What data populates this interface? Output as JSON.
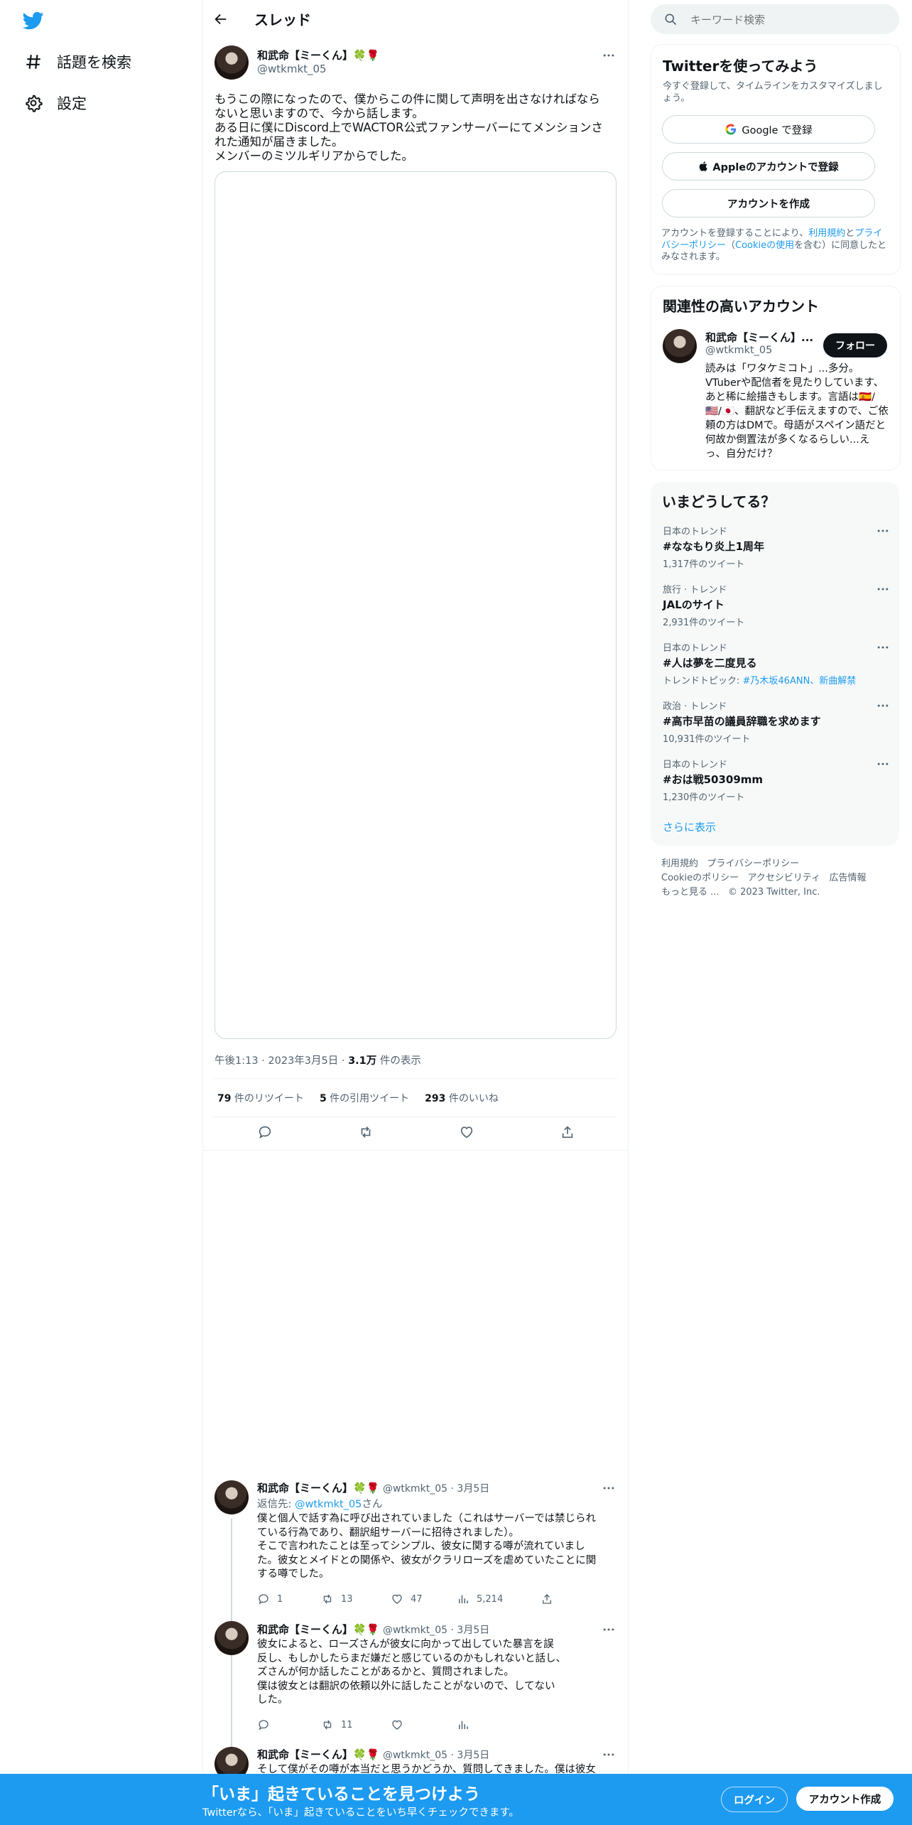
{
  "nav": {
    "explore_label": "話題を検索",
    "settings_label": "設定"
  },
  "thread": {
    "header_title": "スレッド",
    "main_tweet": {
      "author_name": "和武命【ミーくん】🍀🌹",
      "author_handle": "@wtkmkt_05",
      "lines": [
        "もうこの際になったので、僕からこの件に関して声明を出さなければなら",
        "ないと思いますので、今から話します。",
        "ある日に僕にDiscord上でWACTOR公式ファンサーバーにてメンションさ",
        "れた通知が届きました。",
        "メンバーのミツルギリアからでした。"
      ],
      "timestamp": "午後1:13 · 2023年3月5日 · ",
      "views_count": "3.1万",
      "views_label": " 件の表示",
      "retweets_count": "79",
      "retweets_label": " 件のリツイート",
      "quotes_count": "5",
      "quotes_label": " 件の引用ツイート",
      "likes_count": "293",
      "likes_label": " 件のいいね"
    },
    "replies": [
      {
        "author_name": "和武命【ミーくん】🍀🌹",
        "meta": "@wtkmkt_05 · 3月5日",
        "reply_to_prefix": "返信先: ",
        "reply_to_handle": "@wtkmkt_05",
        "reply_to_suffix": "さん",
        "lines": [
          "僕と個人で話す為に呼び出されていました（これはサーバーでは禁じられ",
          "ている行為であり、翻訳組サーバーに招待されました）。",
          "そこで言われたことは至ってシンプル、彼女に関する噂が流れていまし",
          "た。彼女とメイドとの関係や、彼女がクラリローズを虐めていたことに関",
          "する噂でした。"
        ],
        "reply_count": "1",
        "retweet_count": "13",
        "like_count": "47",
        "view_count": "5,214"
      },
      {
        "author_name": "和武命【ミーくん】🍀🌹",
        "meta": "@wtkmkt_05 · 3月5日",
        "lines": [
          "彼女によると、ローズさんが彼女に向かって出していた暴言を誤",
          "反し、もしかしたらまだ嫌だと感じているのかもしれないと話し、",
          "ズさんが何か話したことがあるかと、質問されました。",
          "僕は彼女とは翻訳の依頼以外に話したことがないので、してない",
          "した。"
        ],
        "reply_count": "",
        "retweet_count": "11",
        "like_count": "",
        "view_count": ""
      },
      {
        "author_name": "和武命【ミーくん】🍀🌹",
        "meta": "@wtkmkt_05 · 3月5日",
        "lines": [
          "そして僕がその噂が本当だと思うかどうか、質問してきました。僕は彼女"
        ]
      }
    ]
  },
  "sidebar": {
    "search_placeholder": "キーワード検索",
    "signup": {
      "title": "Twitterを使ってみよう",
      "subtitle": "今すぐ登録して、タイムラインをカスタマイズしましょう。",
      "google_label": "Google で登録",
      "apple_label": "Appleのアカウントで登録",
      "create_label": "アカウントを作成",
      "terms_prefix": "アカウントを登録することにより、",
      "terms_link": "利用規約",
      "terms_and": "と",
      "privacy_link": "プライバシーポリシー",
      "cookie_open": "（",
      "cookie_link": "Cookieの使用",
      "terms_suffix": "を含む）に同意したとみなされます。"
    },
    "related": {
      "title": "関連性の高いアカウント",
      "name": "和武命【ミーくん】...",
      "handle": "@wtkmkt_05",
      "follow_label": "フォロー",
      "bio": "読みは「ワタケミコト」...多分。VTuberや配信者を見たりしています、あと稀に絵描きもします。言語は🇪🇸/🇺🇸/🇯🇵、翻訳など手伝えますので、ご依頼の方はDMで。母語がスペイン語だと何故か倒置法が多くなるらしい...えっ、自分だけ？"
    },
    "trends": {
      "title": "いまどうしてる？",
      "items": [
        {
          "context": "日本のトレンド",
          "title": "#ななもり炎上1周年",
          "count": "1,317件のツイート"
        },
        {
          "context": "旅行 · トレンド",
          "title": "JALのサイト",
          "count": "2,931件のツイート"
        },
        {
          "context": "日本のトレンド",
          "title": "#人は夢を二度見る",
          "count_prefix": "トレンドトピック: ",
          "count_links": "#乃木坂46ANN、新曲解禁"
        },
        {
          "context": "政治 · トレンド",
          "title": "#高市早苗の議員辞職を求めます",
          "count": "10,931件のツイート"
        },
        {
          "context": "日本のトレンド",
          "title": "#おは戦50309mm",
          "count": "1,230件のツイート"
        }
      ],
      "show_more": "さらに表示"
    },
    "footer": {
      "terms": "利用規約",
      "privacy": "プライバシーポリシー",
      "cookie": "Cookieのポリシー",
      "accessibility": "アクセシビリティ",
      "ads": "広告情報",
      "more": "もっと見る ...",
      "copyright": "© 2023 Twitter, Inc."
    }
  },
  "bottom_bar": {
    "headline": "「いま」起きていることを見つけよう",
    "sub": "Twitterなら、「いま」起きていることをいち早くチェックできます。",
    "login_label": "ログイン",
    "signup_label": "アカウント作成"
  },
  "colors": {
    "accent": "#1d9bf0",
    "text": "#0f1419",
    "muted": "#536471"
  }
}
